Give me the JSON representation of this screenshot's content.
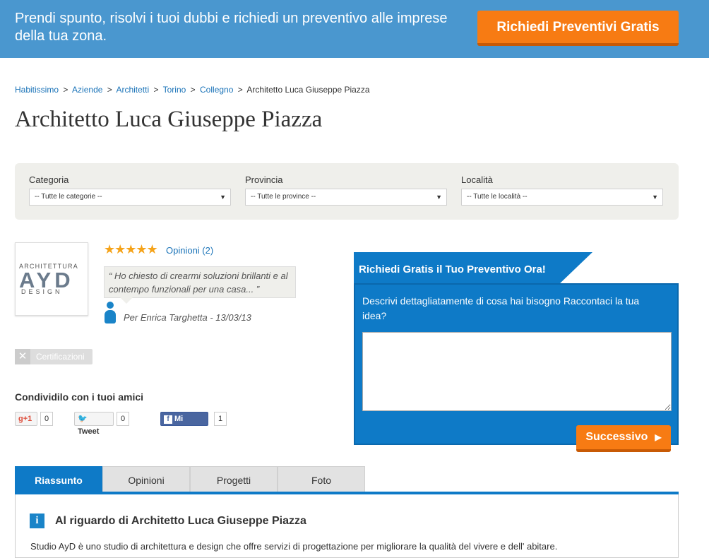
{
  "banner": {
    "message": "Prendi spunto, risolvi i tuoi dubbi e richiedi un preventivo alle imprese della tua zona.",
    "cta_label": "Richiedi Preventivi Gratis"
  },
  "breadcrumb": {
    "items": [
      "Habitissimo",
      "Aziende",
      "Architetti",
      "Torino",
      "Collegno"
    ],
    "current": "Architetto Luca Giuseppe Piazza",
    "separator": ">"
  },
  "page_title": "Architetto Luca Giuseppe Piazza",
  "filters": {
    "category": {
      "label": "Categoria",
      "selected": "-- Tutte le categorie --"
    },
    "province": {
      "label": "Provincia",
      "selected": "-- Tutte le province --"
    },
    "locality": {
      "label": "Località",
      "selected": "-- Tutte le località --"
    }
  },
  "profile": {
    "logo_lines": [
      "ARCHITETTURA",
      "AYD",
      "DESIGN"
    ],
    "rating_stars": "★★★★★",
    "rating_value": 5,
    "opinions_label": "Opinioni (2)",
    "quote_open": "“",
    "quote_text": "Ho chiesto di crearmi soluzioni brillanti e al contempo funzionali per una casa...",
    "quote_close": "”",
    "review_author": "Per Enrica Targhetta - 13/03/13",
    "cert_label": "Certificazioni",
    "cert_icon": "✕"
  },
  "share": {
    "title": "Condividilo con i tuoi amici",
    "gplus_label": "g+1",
    "gplus_count": "0",
    "tweet_label": "Tweet",
    "tweet_count": "0",
    "fb_icon": "f",
    "fb_label": "Mi piace",
    "fb_count": "1"
  },
  "quote_form": {
    "title": "Richiedi Gratis il Tuo Preventivo Ora!",
    "description": "Descrivi dettagliatamente di cosa hai bisogno Raccontaci la tua idea?",
    "textarea_value": "",
    "next_label": "Successivo",
    "next_icon": "▶"
  },
  "tabs": [
    {
      "label": "Riassunto",
      "active": true
    },
    {
      "label": "Opinioni",
      "active": false
    },
    {
      "label": "Progetti",
      "active": false
    },
    {
      "label": "Foto",
      "active": false
    }
  ],
  "about": {
    "info_icon": "i",
    "heading": "Al riguardo di Architetto Luca Giuseppe Piazza",
    "text": "Studio AyD è uno studio di architettura e design che offre servizi di progettazione per migliorare la qualità del vivere e dell' abitare."
  },
  "colors": {
    "banner_bg": "#4a97cf",
    "accent_orange": "#f77b13",
    "accent_blue": "#0e7ac7",
    "star_color": "#f5a31a"
  }
}
